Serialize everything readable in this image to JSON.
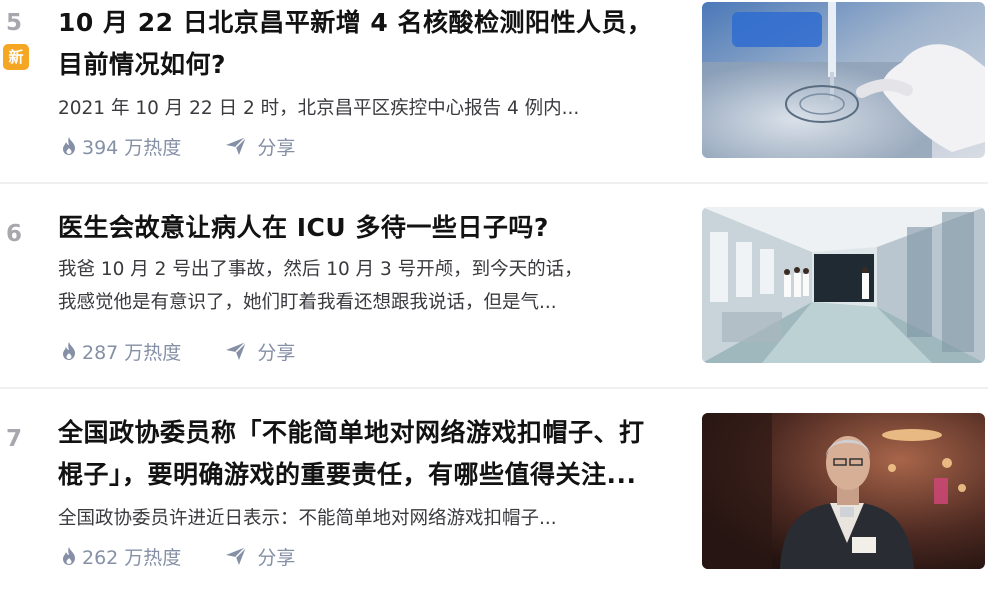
{
  "items": [
    {
      "rank": "5",
      "badge": "新",
      "title_lines": [
        "10 月 22 日北京昌平新增 4 名核酸检测阳性人员，",
        "目前情况如何?"
      ],
      "excerpt_lines": [
        "2021 年 10 月 22 日 2 时，北京昌平区疾控中心报告 4 例内..."
      ],
      "heat": "394 万热度",
      "share": "分享",
      "image_icon": "lab-test-photo"
    },
    {
      "rank": "6",
      "title_lines": [
        "医生会故意让病人在 ICU 多待一些日子吗?"
      ],
      "excerpt_lines": [
        "我爸 10 月 2 号出了事故，然后 10 月 3 号开颅，到今天的话，",
        "我感觉他是有意识了，她们盯着我看还想跟我说话，但是气..."
      ],
      "heat": "287 万热度",
      "share": "分享",
      "image_icon": "hospital-corridor-photo"
    },
    {
      "rank": "7",
      "title_lines": [
        "全国政协委员称「不能简单地对网络游戏扣帽子、打",
        "棍子」，要明确游戏的重要责任，有哪些值得关注..."
      ],
      "excerpt_lines": [
        "全国政协委员许进近日表示：不能简单地对网络游戏扣帽子..."
      ],
      "heat": "262 万热度",
      "share": "分享",
      "image_icon": "man-portrait-photo"
    }
  ],
  "colors": {
    "badge": "#f5a623",
    "meta": "#8590a6",
    "rank": "#a7a7ad"
  }
}
